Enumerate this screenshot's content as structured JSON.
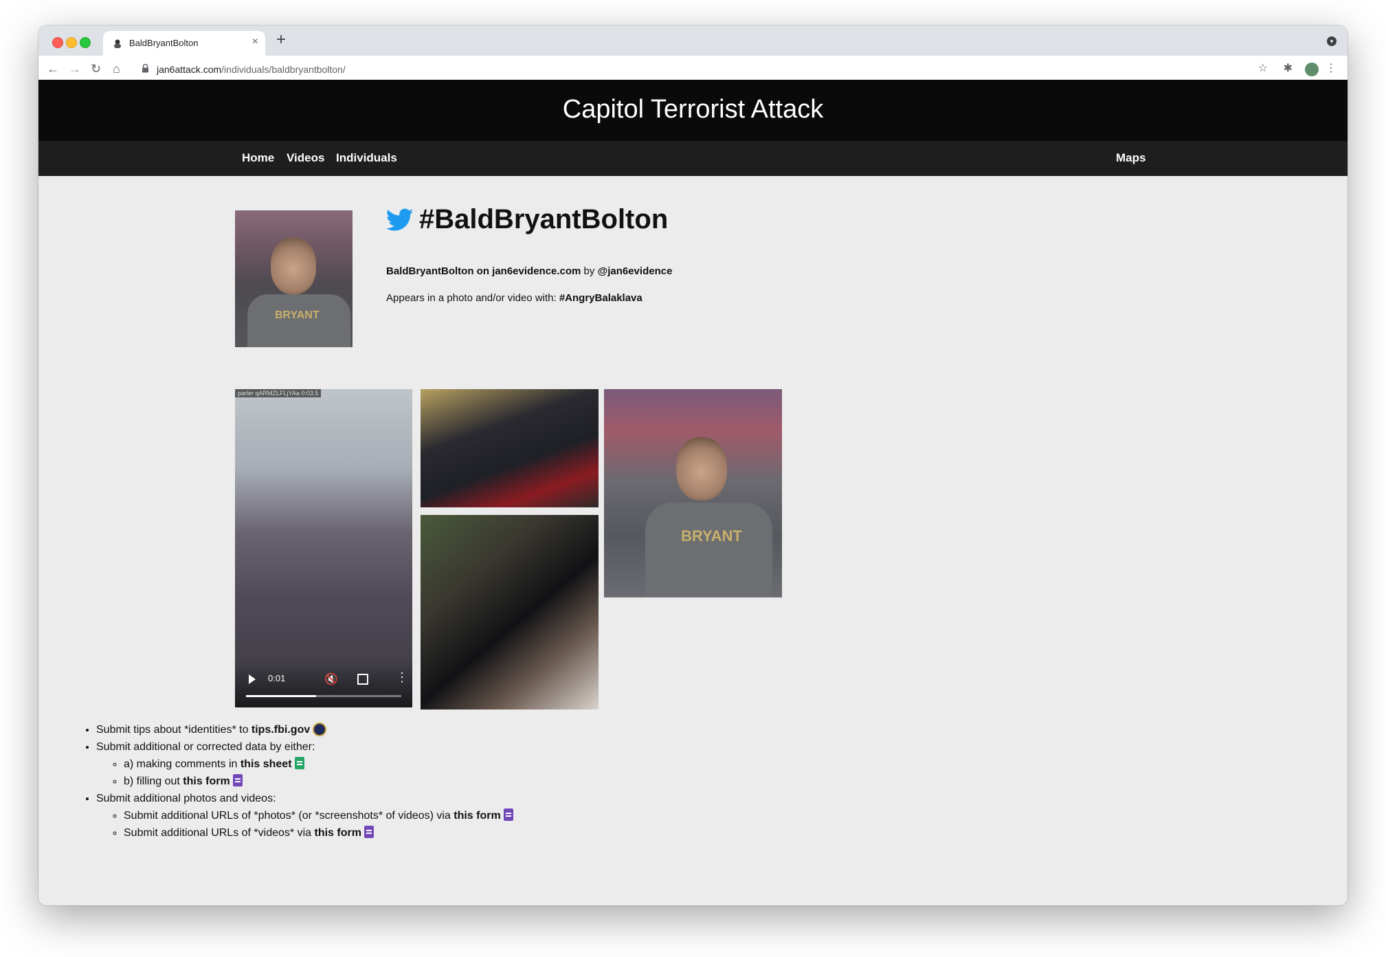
{
  "browser": {
    "tab_title": "BaldBryantBolton",
    "url_domain": "jan6attack.com",
    "url_path": "/individuals/baldbryantbolton/"
  },
  "site": {
    "title": "Capitol Terrorist Attack",
    "nav": [
      "Home",
      "Videos",
      "Individuals",
      "Maps"
    ]
  },
  "individual": {
    "handle": "#BaldBryantBolton",
    "source_link": "BaldBryantBolton on jan6evidence.com",
    "source_by": " by ",
    "source_author": "@jan6evidence",
    "appears_prefix": "Appears in a photo and/or video with: ",
    "appears_with": "#AngryBalaklava"
  },
  "media": {
    "video_caption": "parler qARMZLFLjYAa 0:03.5",
    "video_time": "0:01",
    "video_progress": 0.45,
    "photo_text": "BRYANT"
  },
  "tips": {
    "item1_prefix": "Submit tips about *identities* to ",
    "item1_link": "tips.fbi.gov",
    "item2": "Submit additional or corrected data by either:",
    "item2a_prefix": "a) making comments in ",
    "item2a_link": "this sheet",
    "item2b_prefix": "b) filling out ",
    "item2b_link": "this form",
    "item3": "Submit additional photos and videos:",
    "item3a_prefix": "Submit additional URLs of *photos* (or *screenshots* of videos) via ",
    "item3a_link": "this form",
    "item3b_prefix": "Submit additional URLs of *videos* via ",
    "item3b_link": "this form"
  },
  "colors": {
    "header_bg": "#0a0a0a",
    "nav_bg": "#1e1e1e",
    "page_bg": "#ececec",
    "twitter_blue": "#1d9bf0"
  }
}
